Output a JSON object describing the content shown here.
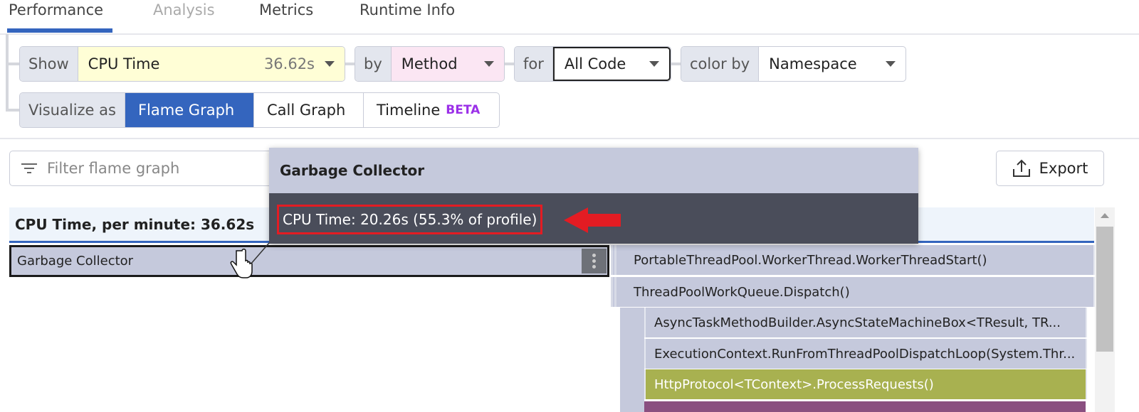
{
  "tabs": [
    {
      "label": "Performance",
      "active": true
    },
    {
      "label": "Analysis"
    },
    {
      "label": "Metrics"
    },
    {
      "label": "Runtime Info"
    }
  ],
  "controls": {
    "show_label": "Show",
    "show_value": "CPU Time",
    "show_total": "36.62s",
    "by_label": "by",
    "by_value": "Method",
    "for_label": "for",
    "for_value": "All Code",
    "colorby_label": "color by",
    "colorby_value": "Namespace",
    "visualize_label": "Visualize as",
    "visualize_options": [
      "Flame Graph",
      "Call Graph",
      "Timeline"
    ],
    "beta": "BETA"
  },
  "filter": {
    "placeholder": "Filter flame graph"
  },
  "export_label": "Export",
  "header": "CPU Time, per minute: 36.62s",
  "tooltip": {
    "title": "Garbage Collector",
    "detail": "CPU Time: 20.26s (55.3% of profile)"
  },
  "frames": {
    "selected": "Garbage Collector",
    "stack": [
      "PortableThreadPool.WorkerThread.WorkerThreadStart()",
      "ThreadPoolWorkQueue.Dispatch()",
      "AsyncTaskMethodBuilder.AsyncStateMachineBox<TResult, TR...",
      "ExecutionContext.RunFromThreadPoolDispatchLoop(System.Thr...",
      "HttpProtocol<TContext>.ProcessRequests()"
    ]
  },
  "colors": {
    "accent": "#3465be",
    "frame": "#c5c9dc",
    "green": "#a8b150",
    "purple": "#8a4f80",
    "highlight": "#e31c23"
  }
}
